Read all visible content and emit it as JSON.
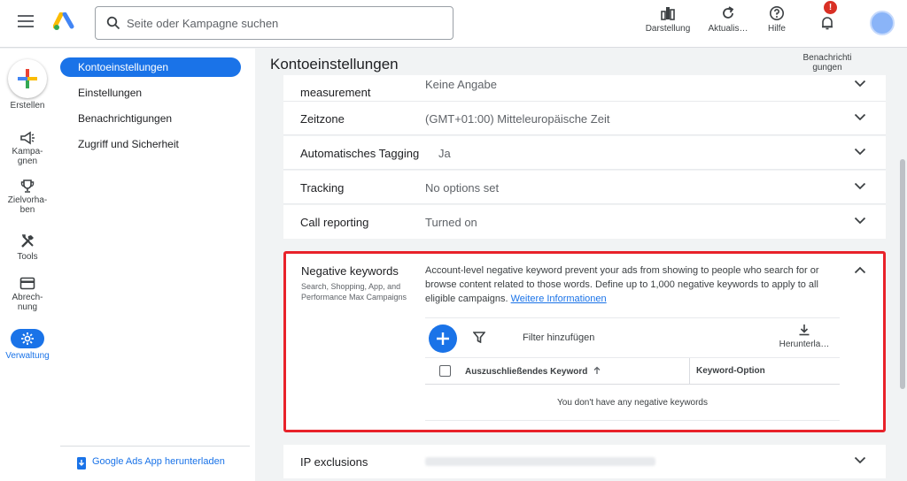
{
  "header": {
    "search_placeholder": "Seite oder Kampagne suchen",
    "buttons": [
      {
        "label": "Darstellung",
        "icon": "chart-icon"
      },
      {
        "label": "Aktualis…",
        "icon": "refresh-icon"
      },
      {
        "label": "Hilfe",
        "icon": "help-icon"
      },
      {
        "label": "Benachrichti\ngungen",
        "icon": "bell-icon"
      }
    ],
    "notification_badge": "!"
  },
  "rail": {
    "create_label": "Erstellen",
    "items": [
      {
        "label": "Kampa-\ngnen",
        "icon": "megaphone-icon"
      },
      {
        "label": "Zielvorha-\nben",
        "icon": "trophy-icon"
      },
      {
        "label": "Tools",
        "icon": "tools-icon"
      },
      {
        "label": "Abrech-\nnung",
        "icon": "credit-card-icon"
      },
      {
        "label": "Verwaltung",
        "icon": "gear-icon",
        "active": true
      }
    ]
  },
  "subnav": {
    "items": [
      {
        "label": "Kontoeinstellungen",
        "active": true
      },
      {
        "label": "Einstellungen"
      },
      {
        "label": "Benachrichtigungen"
      },
      {
        "label": "Zugriff und Sicherheit"
      }
    ],
    "app_link": "Google Ads App herunterladen"
  },
  "main": {
    "title": "Kontoeinstellungen",
    "rows": [
      {
        "label": "measurement",
        "value": "Keine Angabe"
      },
      {
        "label": "Zeitzone",
        "value": "(GMT+01:00) Mitteleuropäische Zeit"
      },
      {
        "label": "Automatisches Tagging",
        "value": "Ja"
      },
      {
        "label": "Tracking",
        "value": "No options set"
      },
      {
        "label": "Call reporting",
        "value": "Turned on"
      }
    ],
    "negative_keywords": {
      "title": "Negative keywords",
      "subtitle": "Search, Shopping, App, and Performance Max Campaigns",
      "description": "Account-level negative keyword prevent your ads from showing to people who search for or browse content related to those words. Define up to 1,000 negative keywords to apply to all eligible campaigns.",
      "link": "Weitere Informationen",
      "filter_label": "Filter hinzufügen",
      "download_label": "Herunterla…",
      "col_keyword": "Auszuschließendes Keyword",
      "col_option": "Keyword-Option",
      "empty": "You don't have any negative keywords"
    },
    "ip_exclusions": {
      "label": "IP exclusions"
    }
  },
  "colors": {
    "accent": "#1a73e8",
    "highlight_border": "#e8222a",
    "badge": "#d93025"
  }
}
